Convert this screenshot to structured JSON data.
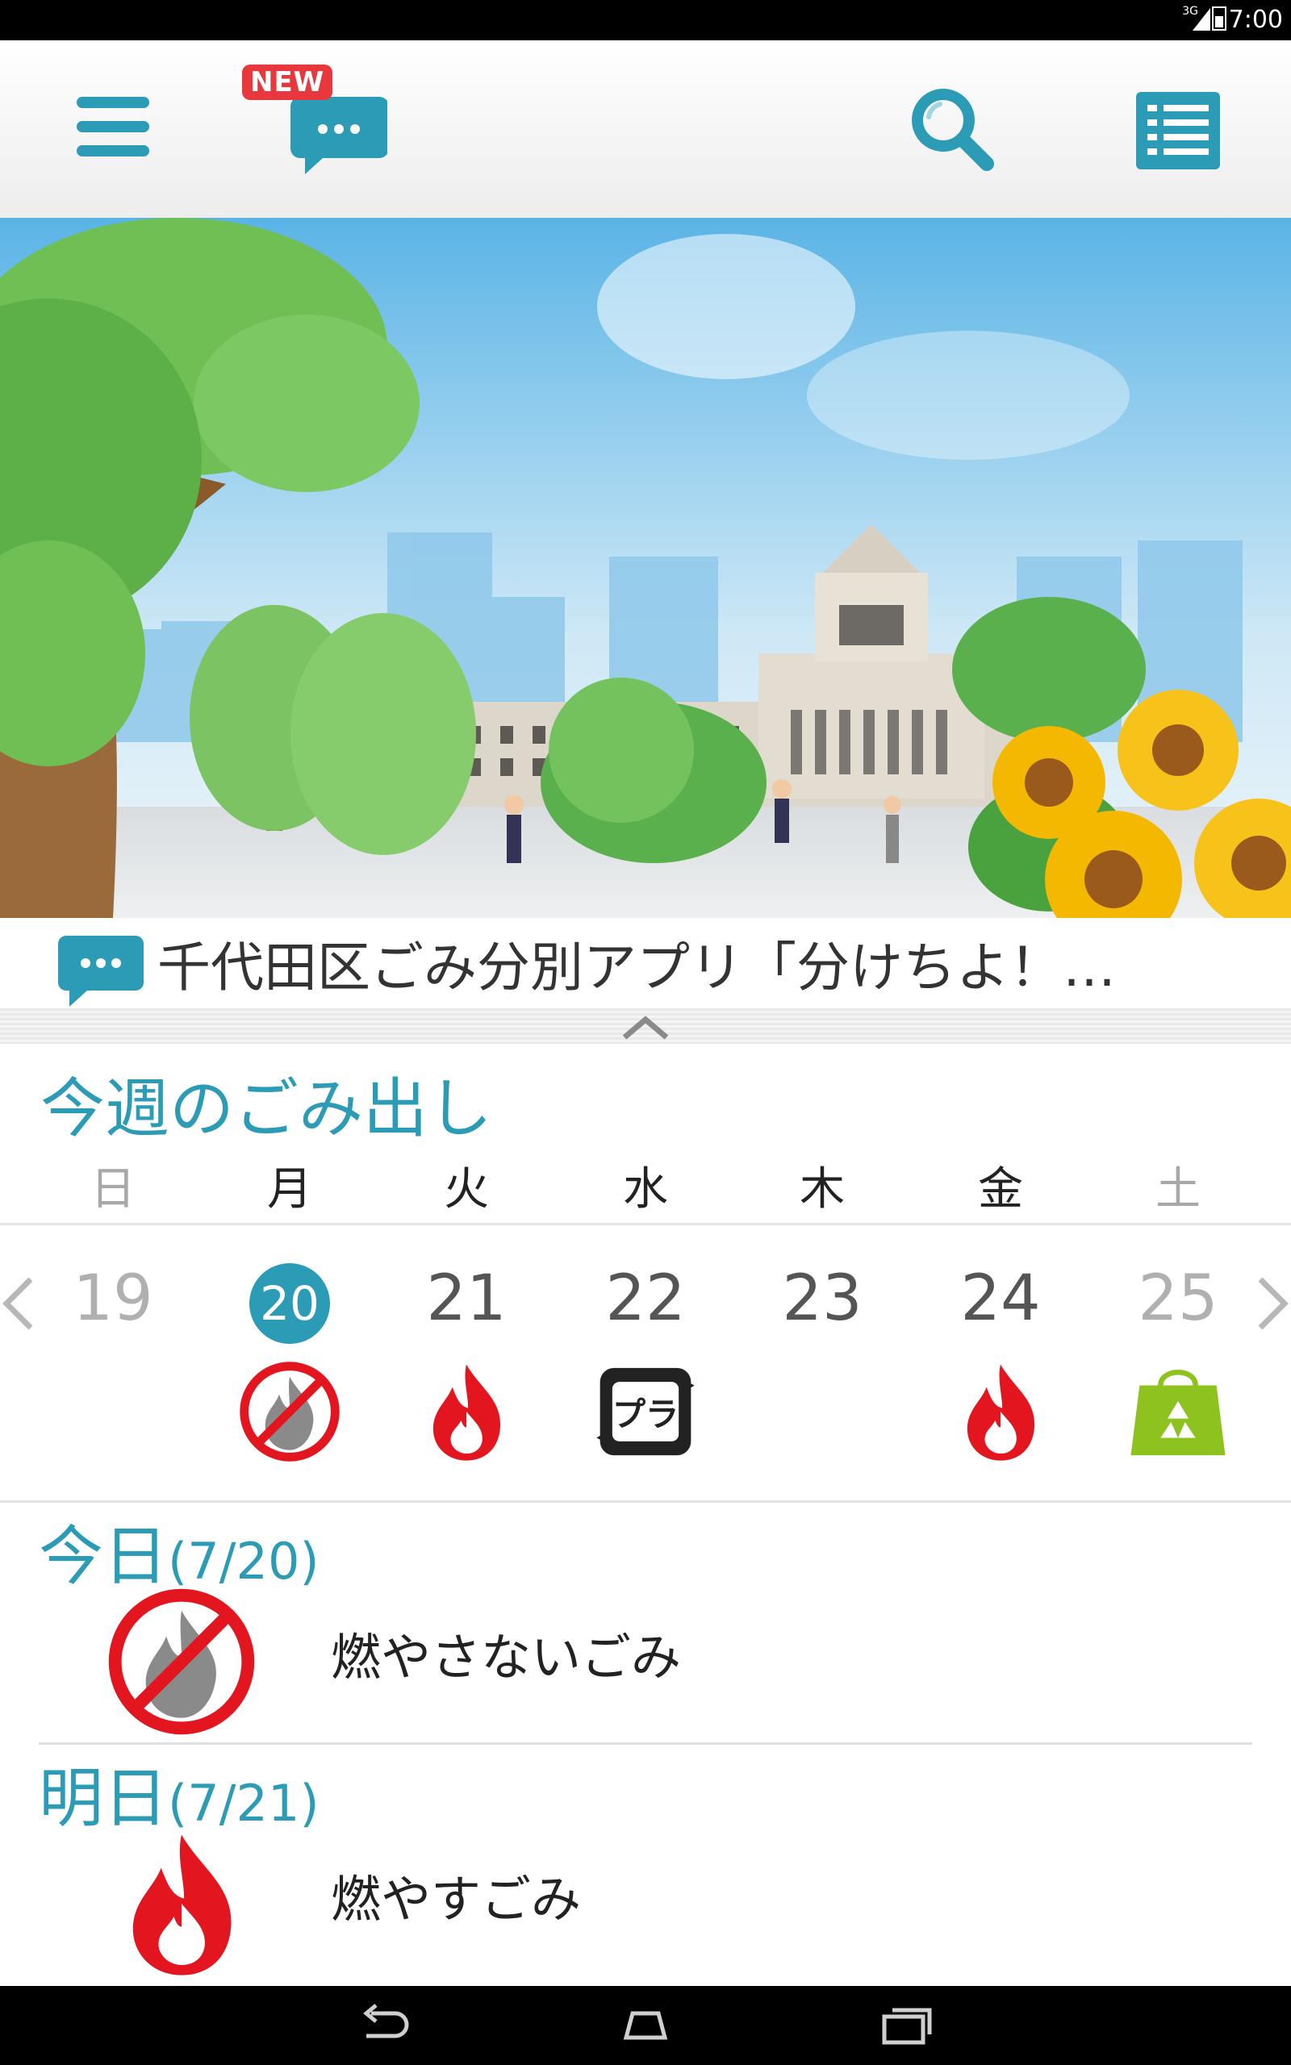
{
  "status_bar": {
    "network": "3G",
    "time": "7:00"
  },
  "app_bar": {
    "news_badge": "NEW",
    "icons": [
      "menu-icon",
      "chat-bubble-icon",
      "search-icon",
      "list-icon"
    ]
  },
  "news": {
    "text": "千代田区ごみ分別アプリ「分けちよ！…"
  },
  "week": {
    "title": "今週のごみ出し",
    "weekdays": [
      "日",
      "月",
      "火",
      "水",
      "木",
      "金",
      "土"
    ],
    "days": [
      {
        "num": "19",
        "icon": "none"
      },
      {
        "num": "20",
        "icon": "non-burnable-icon"
      },
      {
        "num": "21",
        "icon": "burnable-fire-icon"
      },
      {
        "num": "22",
        "icon": "plastic-recycle-icon"
      },
      {
        "num": "23",
        "icon": "none"
      },
      {
        "num": "24",
        "icon": "burnable-fire-icon"
      },
      {
        "num": "25",
        "icon": "recycle-bag-icon"
      }
    ]
  },
  "today": {
    "label": "今日",
    "date": "(7/20)",
    "item": "燃やさないごみ"
  },
  "tomorrow": {
    "label": "明日",
    "date": "(7/21)",
    "item": "燃やすごみ"
  },
  "colors": {
    "accent": "#2b9bb6",
    "fire": "#e3161f",
    "recycle_green": "#8dc21f"
  }
}
